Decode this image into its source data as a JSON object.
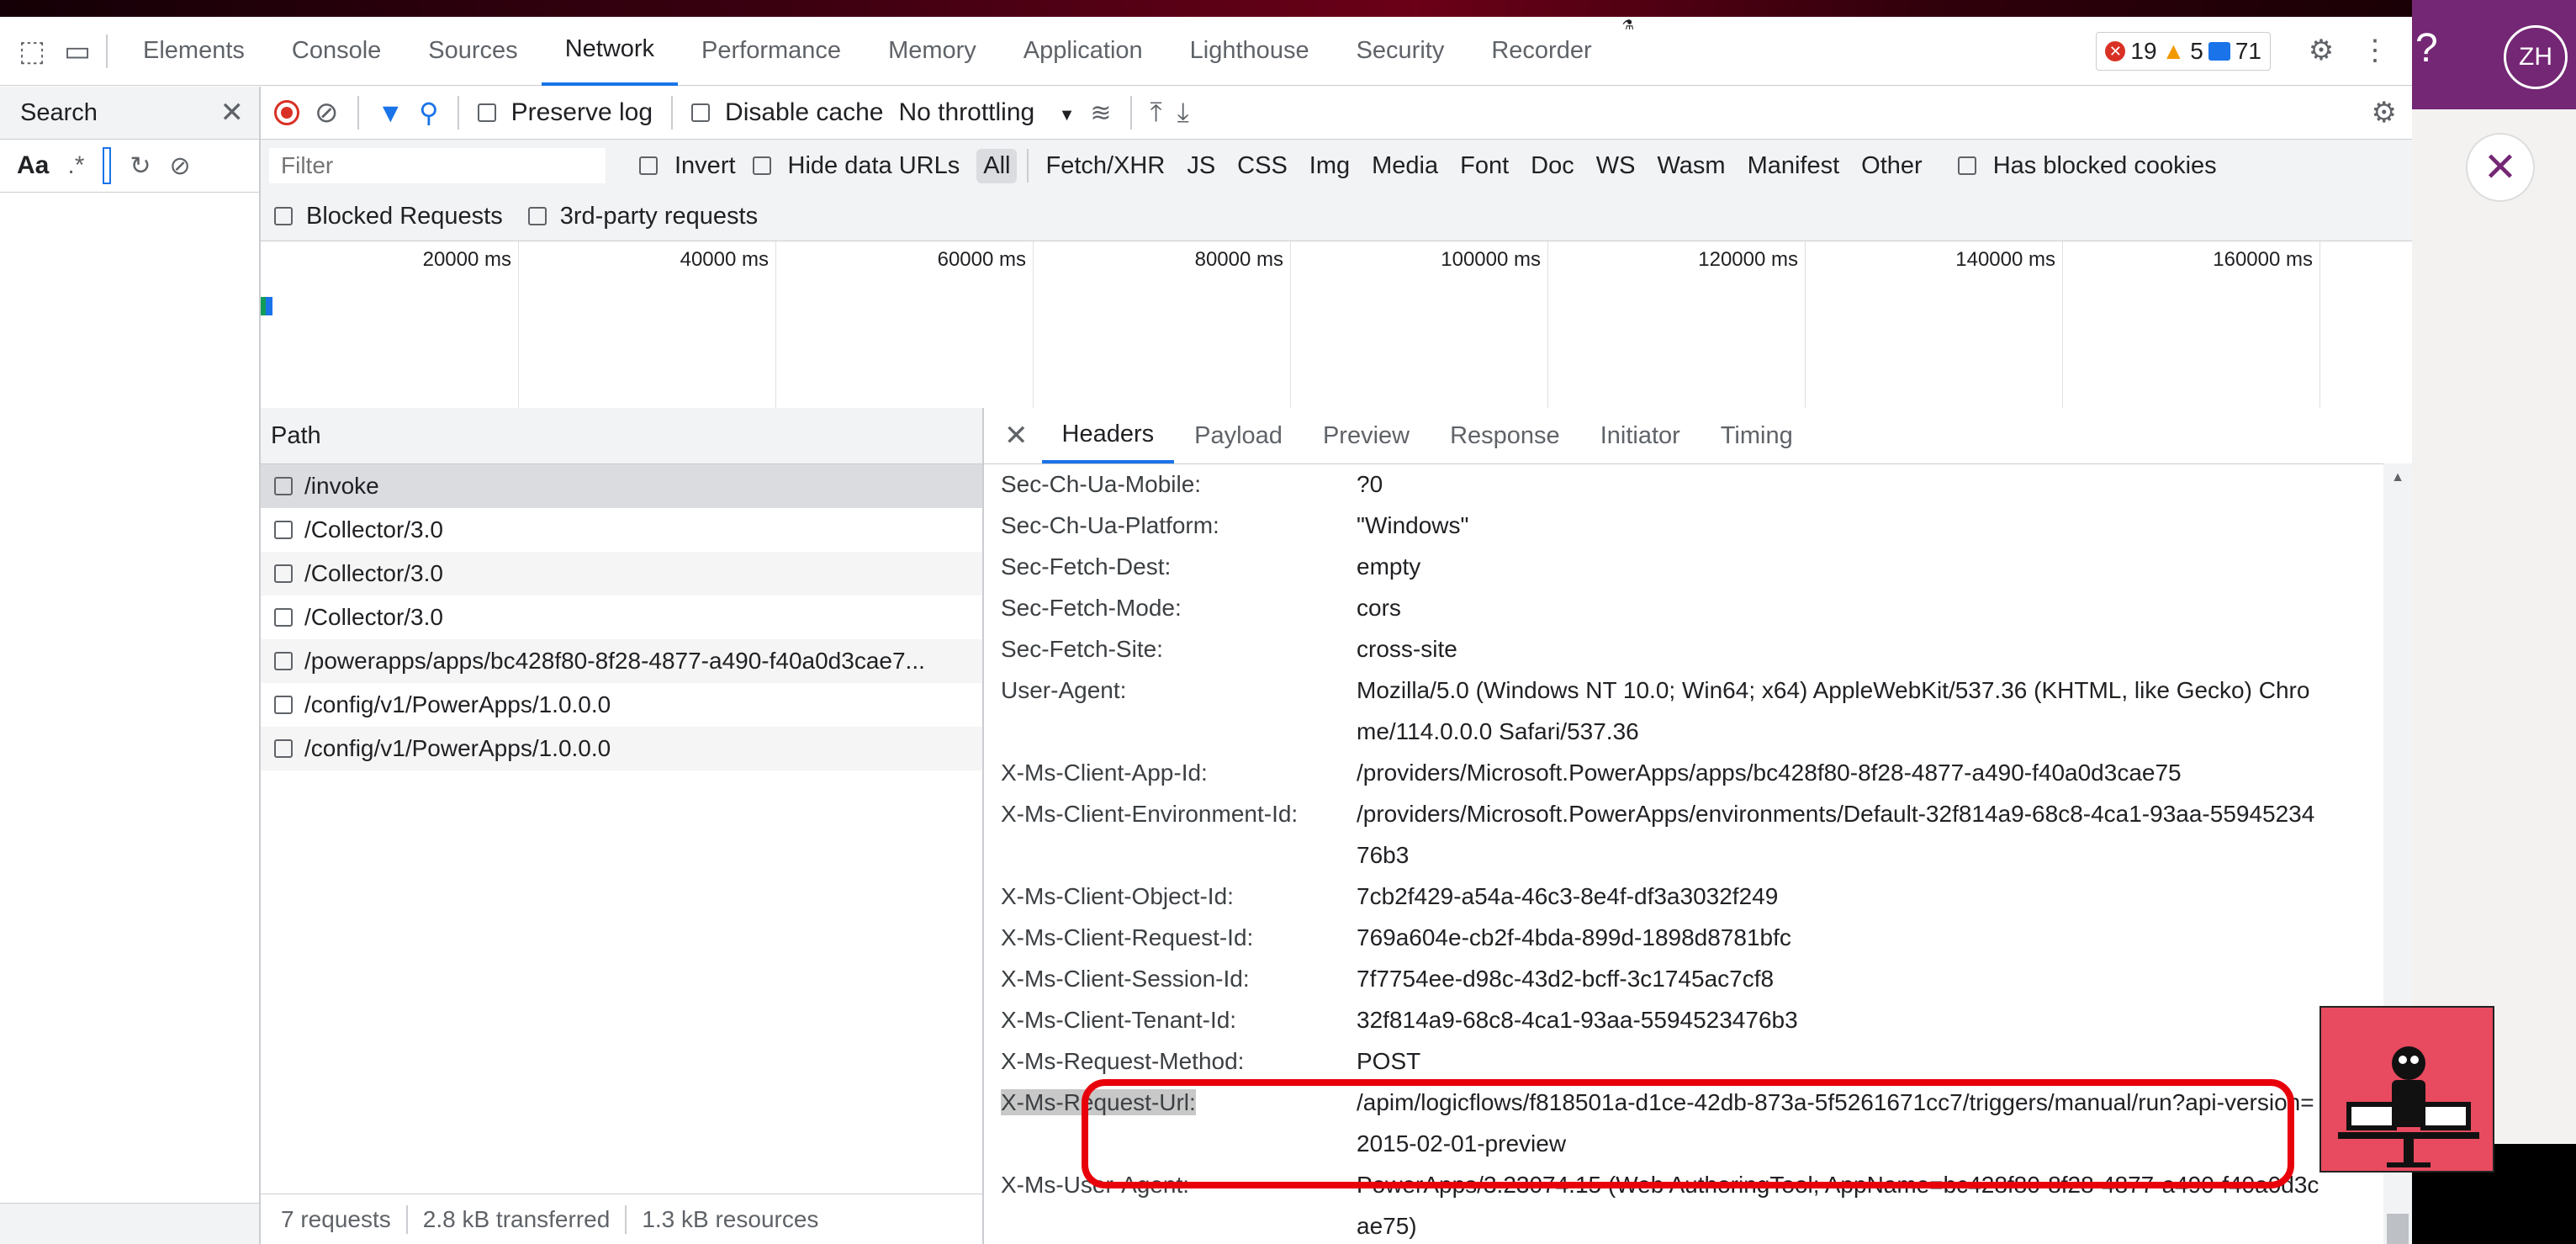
{
  "tabs": [
    "Elements",
    "Console",
    "Sources",
    "Network",
    "Performance",
    "Memory",
    "Application",
    "Lighthouse",
    "Security",
    "Recorder"
  ],
  "active_tab": "Network",
  "badges": {
    "errors": "19",
    "warnings": "5",
    "messages": "71"
  },
  "search": {
    "title": "Search",
    "case_label": "Aa",
    "regex_label": ".*"
  },
  "network_toolbar": {
    "preserve_log": "Preserve log",
    "disable_cache": "Disable cache",
    "throttling": "No throttling"
  },
  "filter": {
    "placeholder": "Filter",
    "invert": "Invert",
    "hide_data_urls": "Hide data URLs",
    "types": [
      "All",
      "Fetch/XHR",
      "JS",
      "CSS",
      "Img",
      "Media",
      "Font",
      "Doc",
      "WS",
      "Wasm",
      "Manifest",
      "Other"
    ],
    "has_blocked_cookies": "Has blocked cookies",
    "blocked_requests": "Blocked Requests",
    "third_party": "3rd-party requests"
  },
  "timeline_ticks": [
    "20000 ms",
    "40000 ms",
    "60000 ms",
    "80000 ms",
    "100000 ms",
    "120000 ms",
    "140000 ms",
    "160000 ms"
  ],
  "request_list": {
    "header": "Path",
    "rows": [
      "/invoke",
      "/Collector/3.0",
      "/Collector/3.0",
      "/Collector/3.0",
      "/powerapps/apps/bc428f80-8f28-4877-a490-f40a0d3cae7...",
      "/config/v1/PowerApps/1.0.0.0",
      "/config/v1/PowerApps/1.0.0.0"
    ],
    "footer": {
      "requests": "7 requests",
      "transferred": "2.8 kB transferred",
      "resources": "1.3 kB resources"
    }
  },
  "detail_tabs": [
    "Headers",
    "Payload",
    "Preview",
    "Response",
    "Initiator",
    "Timing"
  ],
  "headers": [
    {
      "name": "Sec-Ch-Ua-Mobile:",
      "value": "?0"
    },
    {
      "name": "Sec-Ch-Ua-Platform:",
      "value": "\"Windows\""
    },
    {
      "name": "Sec-Fetch-Dest:",
      "value": "empty"
    },
    {
      "name": "Sec-Fetch-Mode:",
      "value": "cors"
    },
    {
      "name": "Sec-Fetch-Site:",
      "value": "cross-site"
    },
    {
      "name": "User-Agent:",
      "value": "Mozilla/5.0 (Windows NT 10.0; Win64; x64) AppleWebKit/537.36 (KHTML, like Gecko) Chrome/114.0.0.0 Safari/537.36"
    },
    {
      "name": "X-Ms-Client-App-Id:",
      "value": "/providers/Microsoft.PowerApps/apps/bc428f80-8f28-4877-a490-f40a0d3cae75"
    },
    {
      "name": "X-Ms-Client-Environment-Id:",
      "value": "/providers/Microsoft.PowerApps/environments/Default-32f814a9-68c8-4ca1-93aa-5594523476b3"
    },
    {
      "name": "X-Ms-Client-Object-Id:",
      "value": "7cb2f429-a54a-46c3-8e4f-df3a3032f249"
    },
    {
      "name": "X-Ms-Client-Request-Id:",
      "value": "769a604e-cb2f-4bda-899d-1898d8781bfc"
    },
    {
      "name": "X-Ms-Client-Session-Id:",
      "value": "7f7754ee-d98c-43d2-bcff-3c1745ac7cf8"
    },
    {
      "name": "X-Ms-Client-Tenant-Id:",
      "value": "32f814a9-68c8-4ca1-93aa-5594523476b3"
    },
    {
      "name": "X-Ms-Request-Method:",
      "value": "POST"
    },
    {
      "name": "X-Ms-Request-Url:",
      "value": "/apim/logicflows/f818501a-d1ce-42db-873a-5f5261671cc7/triggers/manual/run?api-version=2015-02-01-preview"
    },
    {
      "name": "X-Ms-User-Agent:",
      "value": "PowerApps/3.23074.15 (Web AuthoringTool; AppName=bc428f80-8f28-4877-a490-f40a0d3cae75)"
    }
  ],
  "user": {
    "initials": "ZH"
  },
  "help_label": "?",
  "colors": {
    "accent": "#1a73e8",
    "powerapps_purple": "#742774",
    "highlight_red": "#e8000b"
  }
}
